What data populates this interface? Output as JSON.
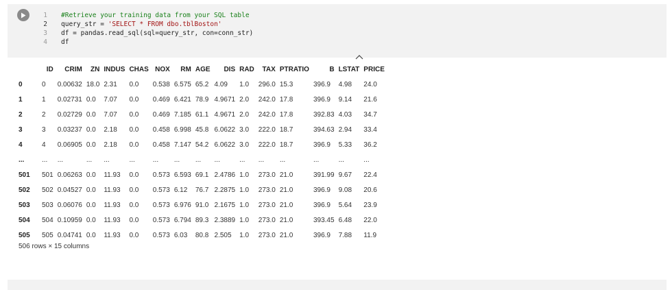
{
  "code_cell": {
    "lines": [
      {
        "num": "1",
        "segments": [
          {
            "text": "#Retrieve your training data from your SQL table",
            "cls": "c-comment"
          }
        ]
      },
      {
        "num": "2",
        "segments": [
          {
            "text": "query_str = ",
            "cls": "c-plain"
          },
          {
            "text": "'SELECT * FROM dbo.tblBoston'",
            "cls": "c-str"
          }
        ]
      },
      {
        "num": "3",
        "segments": [
          {
            "text": "df = pandas.read_sql(sql=query_str, con=conn_str)",
            "cls": "c-plain"
          }
        ]
      },
      {
        "num": "4",
        "segments": [
          {
            "text": "df",
            "cls": "c-plain"
          }
        ]
      }
    ],
    "active_line": "2",
    "run_icon": "play-icon",
    "collapse_icon": "chevron-up-icon"
  },
  "dataframe": {
    "columns": [
      "",
      "ID",
      "CRIM",
      "ZN",
      "INDUS",
      "CHAS",
      "NOX",
      "RM",
      "AGE",
      "DIS",
      "RAD",
      "TAX",
      "PTRATIO",
      "B",
      "LSTAT",
      "PRICE"
    ],
    "rows": [
      {
        "index": "0",
        "cells": [
          "0",
          "0.00632",
          "18.0",
          "2.31",
          "0.0",
          "0.538",
          "6.575",
          "65.2",
          "4.09",
          "1.0",
          "296.0",
          "15.3",
          "396.9",
          "4.98",
          "24.0"
        ]
      },
      {
        "index": "1",
        "cells": [
          "1",
          "0.02731",
          "0.0",
          "7.07",
          "0.0",
          "0.469",
          "6.421",
          "78.9",
          "4.9671",
          "2.0",
          "242.0",
          "17.8",
          "396.9",
          "9.14",
          "21.6"
        ]
      },
      {
        "index": "2",
        "cells": [
          "2",
          "0.02729",
          "0.0",
          "7.07",
          "0.0",
          "0.469",
          "7.185",
          "61.1",
          "4.9671",
          "2.0",
          "242.0",
          "17.8",
          "392.83",
          "4.03",
          "34.7"
        ]
      },
      {
        "index": "3",
        "cells": [
          "3",
          "0.03237",
          "0.0",
          "2.18",
          "0.0",
          "0.458",
          "6.998",
          "45.8",
          "6.0622",
          "3.0",
          "222.0",
          "18.7",
          "394.63",
          "2.94",
          "33.4"
        ]
      },
      {
        "index": "4",
        "cells": [
          "4",
          "0.06905",
          "0.0",
          "2.18",
          "0.0",
          "0.458",
          "7.147",
          "54.2",
          "6.0622",
          "3.0",
          "222.0",
          "18.7",
          "396.9",
          "5.33",
          "36.2"
        ]
      },
      {
        "index": "...",
        "cells": [
          "...",
          "...",
          "...",
          "...",
          "...",
          "...",
          "...",
          "...",
          "...",
          "...",
          "...",
          "...",
          "...",
          "...",
          "..."
        ]
      },
      {
        "index": "501",
        "cells": [
          "501",
          "0.06263",
          "0.0",
          "11.93",
          "0.0",
          "0.573",
          "6.593",
          "69.1",
          "2.4786",
          "1.0",
          "273.0",
          "21.0",
          "391.99",
          "9.67",
          "22.4"
        ]
      },
      {
        "index": "502",
        "cells": [
          "502",
          "0.04527",
          "0.0",
          "11.93",
          "0.0",
          "0.573",
          "6.12",
          "76.7",
          "2.2875",
          "1.0",
          "273.0",
          "21.0",
          "396.9",
          "9.08",
          "20.6"
        ]
      },
      {
        "index": "503",
        "cells": [
          "503",
          "0.06076",
          "0.0",
          "11.93",
          "0.0",
          "0.573",
          "6.976",
          "91.0",
          "2.1675",
          "1.0",
          "273.0",
          "21.0",
          "396.9",
          "5.64",
          "23.9"
        ]
      },
      {
        "index": "504",
        "cells": [
          "504",
          "0.10959",
          "0.0",
          "11.93",
          "0.0",
          "0.573",
          "6.794",
          "89.3",
          "2.3889",
          "1.0",
          "273.0",
          "21.0",
          "393.45",
          "6.48",
          "22.0"
        ]
      },
      {
        "index": "505",
        "cells": [
          "505",
          "0.04741",
          "0.0",
          "11.93",
          "0.0",
          "0.573",
          "6.03",
          "80.8",
          "2.505",
          "1.0",
          "273.0",
          "21.0",
          "396.9",
          "7.88",
          "11.9"
        ]
      }
    ],
    "shape_text": "506 rows × 15 columns"
  }
}
